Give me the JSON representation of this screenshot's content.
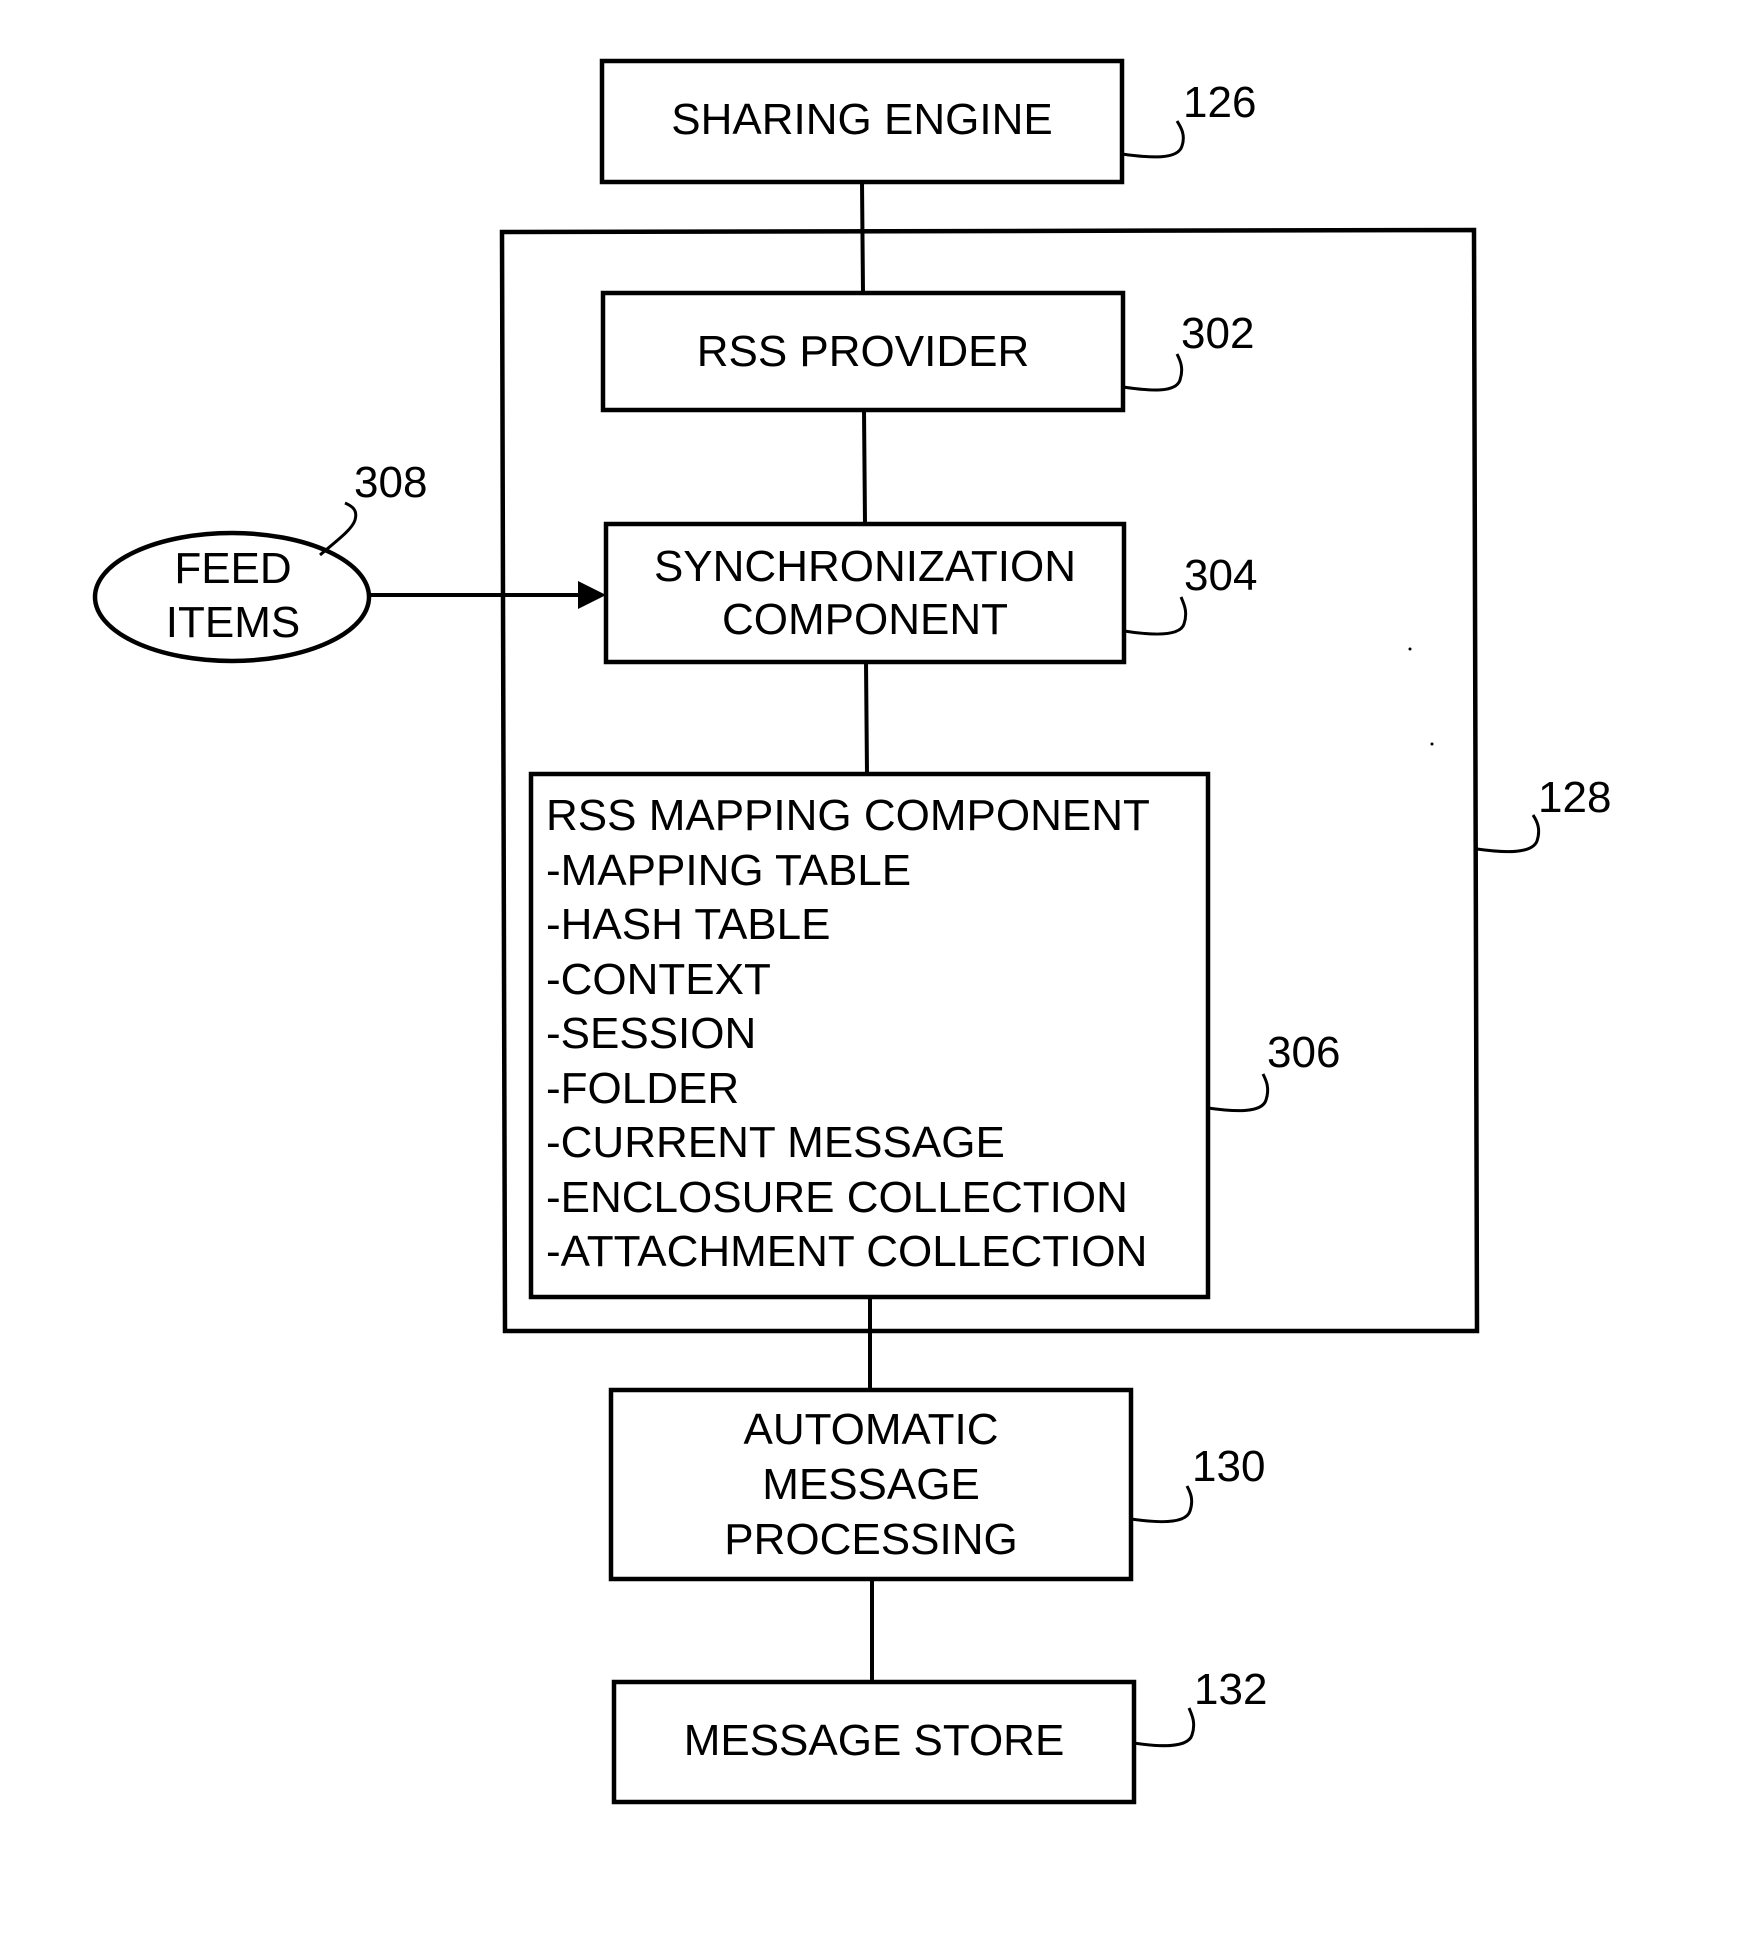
{
  "figure": {
    "nodes": {
      "sharing_engine": {
        "label": "SHARING ENGINE",
        "ref": "126"
      },
      "rss_provider": {
        "label": "RSS PROVIDER",
        "ref": "302"
      },
      "synchronization_component": {
        "lines": [
          "SYNCHRONIZATION",
          "COMPONENT"
        ],
        "ref": "304"
      },
      "rss_mapping_component": {
        "title": "RSS MAPPING COMPONENT",
        "items": [
          "-MAPPING TABLE",
          "-HASH TABLE",
          "-CONTEXT",
          "-SESSION",
          "-FOLDER",
          "-CURRENT MESSAGE",
          "-ENCLOSURE COLLECTION",
          "-ATTACHMENT COLLECTION"
        ],
        "ref": "306"
      },
      "feed_items": {
        "lines": [
          "FEED",
          "ITEMS"
        ],
        "ref": "308"
      },
      "container": {
        "ref": "128"
      },
      "automatic_message_processing": {
        "lines": [
          "AUTOMATIC",
          "MESSAGE",
          "PROCESSING"
        ],
        "ref": "130"
      },
      "message_store": {
        "label": "MESSAGE STORE",
        "ref": "132"
      }
    },
    "edges": [
      {
        "from": "SHARING ENGINE",
        "to": "RSS PROVIDER",
        "type": "line"
      },
      {
        "from": "RSS PROVIDER",
        "to": "SYNCHRONIZATION COMPONENT",
        "type": "line"
      },
      {
        "from": "FEED ITEMS",
        "to": "SYNCHRONIZATION COMPONENT",
        "type": "arrow"
      },
      {
        "from": "SYNCHRONIZATION COMPONENT",
        "to": "RSS MAPPING COMPONENT",
        "type": "line"
      },
      {
        "from": "RSS MAPPING COMPONENT",
        "to": "AUTOMATIC MESSAGE PROCESSING",
        "type": "line"
      },
      {
        "from": "AUTOMATIC MESSAGE PROCESSING",
        "to": "MESSAGE STORE",
        "type": "line"
      }
    ]
  }
}
